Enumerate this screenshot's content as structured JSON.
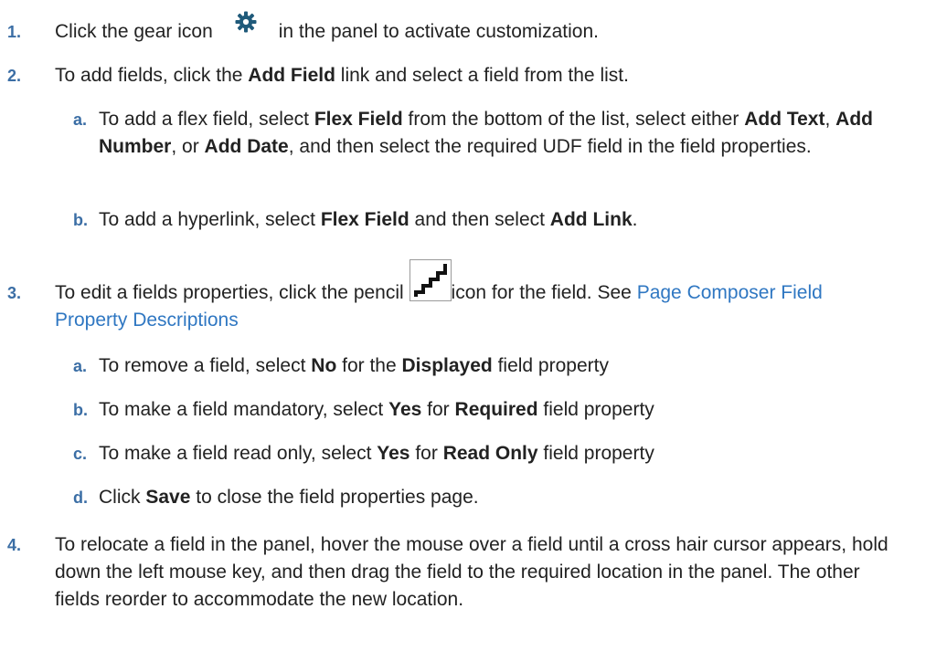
{
  "colors": {
    "text": "#222222",
    "number": "#3b6ea5",
    "link": "#2f77c2",
    "gear_icon": "#1f5a7a"
  },
  "steps": [
    {
      "num": "1.",
      "t1": "Click the gear icon",
      "t2": "in the panel to activate customization."
    },
    {
      "num": "2.",
      "t1": "To add fields, click the",
      "b1": "Add Field",
      "t2": "link and select a field from the list.",
      "subs": [
        {
          "num": "a.",
          "t1": "To add a flex field, select",
          "b1": "Flex Field",
          "t2": "from the bottom of the list, select either",
          "b2": "Add Text",
          "t3": ",",
          "b3": "Add Number",
          "t4": ", or",
          "b4": "Add Date",
          "t5": ", and then select the required UDF field in the field properties."
        },
        {
          "num": "b.",
          "t1": "To add a hyperlink, select",
          "b1": "Flex Field",
          "t2": "and then select",
          "b2": "Add Link",
          "t3": "."
        }
      ]
    },
    {
      "num": "3.",
      "t1": "To edit a fields properties, click the pencil",
      "t2": "icon for the field. See",
      "link": "Page Composer Field Property Descriptions",
      "subs": [
        {
          "num": "a.",
          "t1": "To remove a field, select",
          "b1": "No",
          "t2": "for the",
          "b2": "Displayed",
          "t3": "field property"
        },
        {
          "num": "b.",
          "t1": "To make a field mandatory, select",
          "b1": "Yes",
          "t2": "for",
          "b2": "Required",
          "t3": "field property"
        },
        {
          "num": "c.",
          "t1": "To make a field read only, select",
          "b1": "Yes",
          "t2": "for",
          "b2": "Read Only",
          "t3": "field property"
        },
        {
          "num": "d.",
          "t1": "Click",
          "b1": "Save",
          "t2": "to close the field properties page."
        }
      ]
    },
    {
      "num": "4.",
      "t1": "To relocate a field in the panel, hover the mouse over a field until a cross hair cursor appears, hold down the left mouse key, and then drag the field to the required location in the panel. The other fields reorder to accommodate the new location."
    }
  ]
}
